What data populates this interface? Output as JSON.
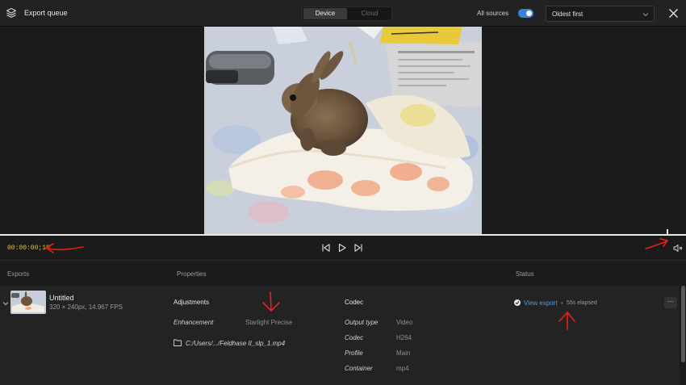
{
  "topbar": {
    "title": "Export queue",
    "tabs": [
      {
        "label": "Device",
        "active": true
      },
      {
        "label": "Cloud",
        "active": false
      }
    ],
    "sources_label": "All sources",
    "sources_toggle_on": true,
    "sort_value": "Oldest first"
  },
  "transport": {
    "timecode": "00:00:00;10"
  },
  "table": {
    "col_exports": "Exports",
    "col_properties": "Properties",
    "col_status": "Status"
  },
  "export_item": {
    "name": "Untitled",
    "meta": "320 × 240px, 14.967 FPS",
    "adjustments_heading": "Adjustments",
    "enhancement_label": "Enhancement",
    "enhancement_value": "Starlight Precise",
    "output_path": "C:/Users/.../Feldhase II_slp_1.mp4",
    "codec_heading": "Codec",
    "codec_props": [
      {
        "label": "Output type",
        "value": "Video"
      },
      {
        "label": "Codec",
        "value": "H264"
      },
      {
        "label": "Profile",
        "value": "Main"
      },
      {
        "label": "Container",
        "value": "mp4"
      }
    ],
    "status_link": "View export",
    "status_sep": "•",
    "elapsed": "55s elapsed",
    "more_label": "···"
  },
  "colors": {
    "accent_blue": "#3b82d6",
    "link_blue": "#4a9cf0",
    "timecode_yellow": "#e2c542",
    "annotation_red": "#e8201a"
  },
  "icons": [
    "layers-icon",
    "chevron-down-icon",
    "close-icon",
    "skip-back-icon",
    "play-icon",
    "skip-forward-icon",
    "volume-muted-icon",
    "folder-icon",
    "check-circle-icon",
    "more-icon"
  ]
}
